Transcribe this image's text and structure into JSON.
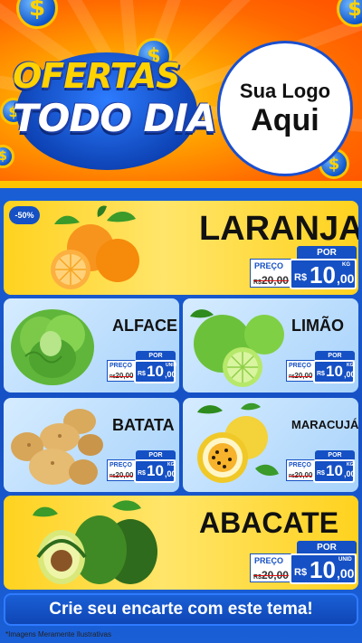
{
  "header": {
    "title_line1": "OFERTAS",
    "title_line2": "TODO DIA",
    "logo_line1": "Sua Logo",
    "logo_line2": "Aqui"
  },
  "products": [
    {
      "name": "LARANJA",
      "discount": "-50%",
      "por": "POR",
      "preco_label": "PREÇO",
      "old_prefix": "R$",
      "old_price": "20,00",
      "currency": "R$",
      "price_int": "10",
      "price_dec": ",00",
      "unit": "KG",
      "image": "oranges"
    },
    {
      "name": "ALFACE",
      "por": "POR",
      "preco_label": "PREÇO",
      "old_prefix": "R$",
      "old_price": "20,00",
      "currency": "R$",
      "price_int": "10",
      "price_dec": ",00",
      "unit": "UNID",
      "image": "lettuce"
    },
    {
      "name": "LIMÃO",
      "por": "POR",
      "preco_label": "PREÇO",
      "old_prefix": "R$",
      "old_price": "20,00",
      "currency": "R$",
      "price_int": "10",
      "price_dec": ",00",
      "unit": "KG",
      "image": "limes"
    },
    {
      "name": "BATATA",
      "por": "POR",
      "preco_label": "PREÇO",
      "old_prefix": "R$",
      "old_price": "20,00",
      "currency": "R$",
      "price_int": "10",
      "price_dec": ",00",
      "unit": "KG",
      "image": "potatoes"
    },
    {
      "name": "MARACUJÁ",
      "por": "POR",
      "preco_label": "PREÇO",
      "old_prefix": "R$",
      "old_price": "20,00",
      "currency": "R$",
      "price_int": "10",
      "price_dec": ",00",
      "unit": "KG",
      "image": "passion-fruit"
    },
    {
      "name": "ABACATE",
      "por": "POR",
      "preco_label": "PREÇO",
      "old_prefix": "R$",
      "old_price": "20,00",
      "currency": "R$",
      "price_int": "10",
      "price_dec": ",00",
      "unit": "UNID",
      "image": "avocados"
    }
  ],
  "banner": "Crie seu encarte com este tema!",
  "footnote": "*Imagens Meramente Ilustrativas",
  "colors": {
    "brand_blue": "#1550c4",
    "accent_yellow": "#ffd21e",
    "header_orange": "#ff6a00",
    "strike_red": "#dd1111"
  }
}
